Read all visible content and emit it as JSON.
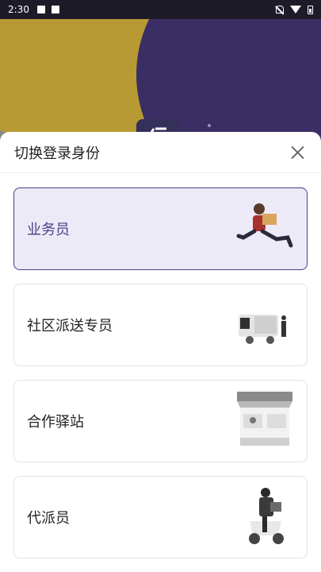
{
  "status_bar": {
    "time": "2:30",
    "icons": [
      "image-icon",
      "a-icon",
      "mute-icon",
      "wifi-icon",
      "battery-icon"
    ]
  },
  "sheet": {
    "title": "切换登录身份",
    "close_icon": "close-icon"
  },
  "roles": [
    {
      "label": "业务员",
      "selected": true,
      "illustration": "courier-running-icon"
    },
    {
      "label": "社区派送专员",
      "selected": false,
      "illustration": "delivery-truck-icon"
    },
    {
      "label": "合作驿站",
      "selected": false,
      "illustration": "storefront-icon"
    },
    {
      "label": "代派员",
      "selected": false,
      "illustration": "scooter-rider-icon"
    }
  ],
  "colors": {
    "accent": "#4a3f85",
    "selected_bg": "#eceaf6",
    "status_bar": "#1d1b28"
  }
}
